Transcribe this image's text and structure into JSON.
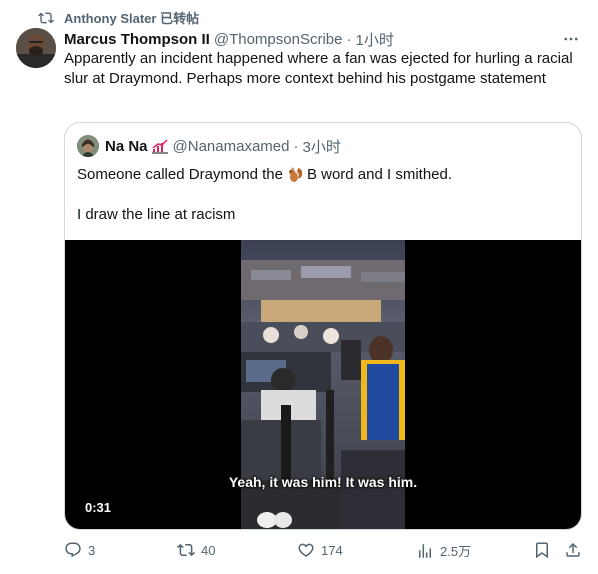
{
  "repost": {
    "text": "Anthony Slater 已转帖"
  },
  "tweet": {
    "name": "Marcus Thompson II",
    "handle": "@ThompsonScribe",
    "dot": "·",
    "time": "1小时",
    "text": "Apparently an incident happened where a fan was ejected for hurling a racial slur at Draymond. Perhaps more context behind his postgame statement"
  },
  "quote": {
    "name": "Na Na",
    "handle": "@Nanamaxamed",
    "dot": "·",
    "time": "3小时",
    "text1_before": "Someone called Draymond the",
    "text1_after": "B word and I smithed.",
    "text2": "I draw the line at racism",
    "video": {
      "caption": "Yeah, it was him! It was him.",
      "duration": "0:31"
    }
  },
  "actions": {
    "reply_count": "3",
    "repost_count": "40",
    "like_count": "174",
    "view_count": "2.5万"
  },
  "colors": {
    "text": "#0f1419",
    "secondary": "#536471",
    "border": "#cfd9de"
  }
}
